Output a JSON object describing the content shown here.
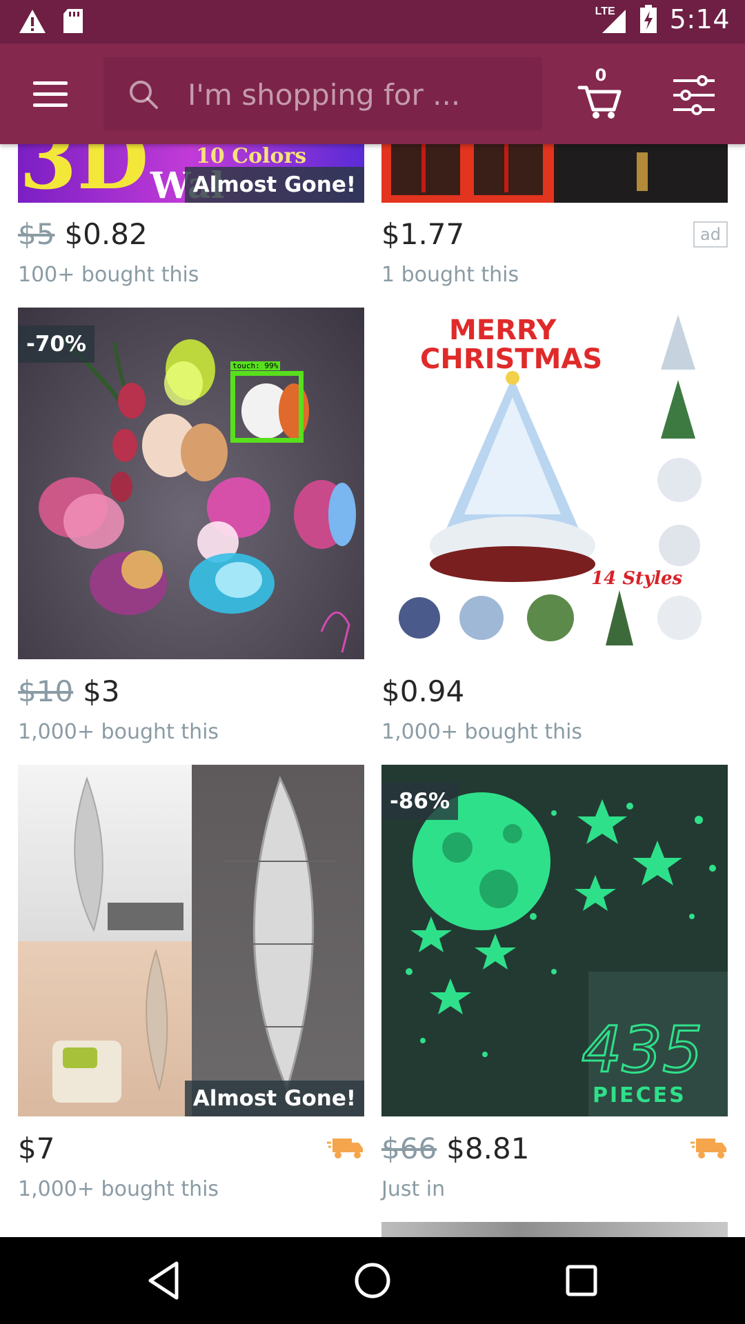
{
  "status_bar": {
    "network": "LTE",
    "time": "5:14"
  },
  "header": {
    "search_placeholder": "I'm shopping for ...",
    "cart_count": "0"
  },
  "products": [
    {
      "old_price": "$5",
      "price": "$0.82",
      "bought": "100+ bought this",
      "badge": "Almost Gone!",
      "image_text_1": "10 Colors",
      "image_text_2": "3D",
      "image_text_3": "Wal"
    },
    {
      "price": "$1.77",
      "bought": "1 bought this",
      "ad": "ad"
    },
    {
      "old_price": "$10",
      "price": "$3",
      "bought": "1,000+ bought this",
      "discount": "-70%",
      "overlay_label": "touch: 99%"
    },
    {
      "price": "$0.94",
      "bought": "1,000+ bought this",
      "image_text_1": "MERRY",
      "image_text_2": "CHRISTMAS",
      "image_text_3": "14 Styles"
    },
    {
      "price": "$7",
      "bought": "1,000+ bought this",
      "badge": "Almost Gone!"
    },
    {
      "old_price": "$66",
      "price": "$8.81",
      "bought": "Just in",
      "discount": "-86%",
      "image_text_1": "435",
      "image_text_2": "PIECES"
    }
  ],
  "colors": {
    "status_bar": "#6e1f43",
    "app_bar": "#85284e",
    "price_gray": "#8a9ba4",
    "truck_orange": "#f5a64c",
    "glow_green": "#2fe08a"
  }
}
